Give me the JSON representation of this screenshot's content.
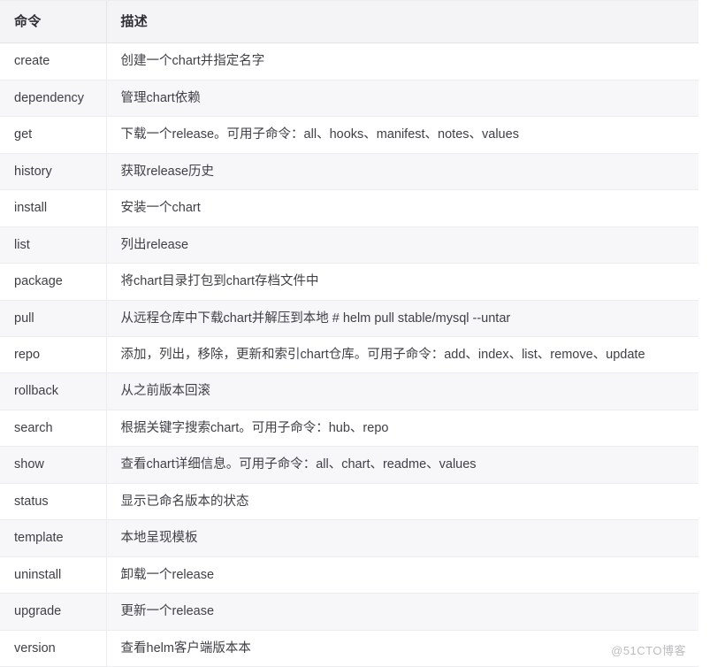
{
  "table": {
    "columns": [
      {
        "key": "command",
        "label": "命令"
      },
      {
        "key": "description",
        "label": "描述"
      }
    ],
    "rows": [
      {
        "command": "create",
        "description": "创建一个chart并指定名字"
      },
      {
        "command": "dependency",
        "description": "管理chart依赖"
      },
      {
        "command": "get",
        "description": "下载一个release。可用子命令：all、hooks、manifest、notes、values"
      },
      {
        "command": "history",
        "description": "获取release历史"
      },
      {
        "command": "install",
        "description": "安装一个chart"
      },
      {
        "command": "list",
        "description": "列出release"
      },
      {
        "command": "package",
        "description": "将chart目录打包到chart存档文件中"
      },
      {
        "command": "pull",
        "description": "从远程仓库中下载chart并解压到本地  # helm pull stable/mysql --untar"
      },
      {
        "command": "repo",
        "description": "添加，列出，移除，更新和索引chart仓库。可用子命令：add、index、list、remove、update"
      },
      {
        "command": "rollback",
        "description": "从之前版本回滚"
      },
      {
        "command": "search",
        "description": "根据关键字搜索chart。可用子命令：hub、repo"
      },
      {
        "command": "show",
        "description": "查看chart详细信息。可用子命令：all、chart、readme、values"
      },
      {
        "command": "status",
        "description": "显示已命名版本的状态"
      },
      {
        "command": "template",
        "description": "本地呈现模板"
      },
      {
        "command": "uninstall",
        "description": "卸载一个release"
      },
      {
        "command": "upgrade",
        "description": "更新一个release"
      },
      {
        "command": "version",
        "description": "查看helm客户端版本本"
      }
    ]
  },
  "watermark": {
    "text": "@51CTO博客"
  },
  "colors": {
    "header_bg": "#f4f4f6",
    "stripe_bg": "#f7f7f9",
    "row_bg": "#ffffff",
    "border": "#ededf1",
    "text": "#3f3f46",
    "watermark": "#b9b9bd"
  }
}
